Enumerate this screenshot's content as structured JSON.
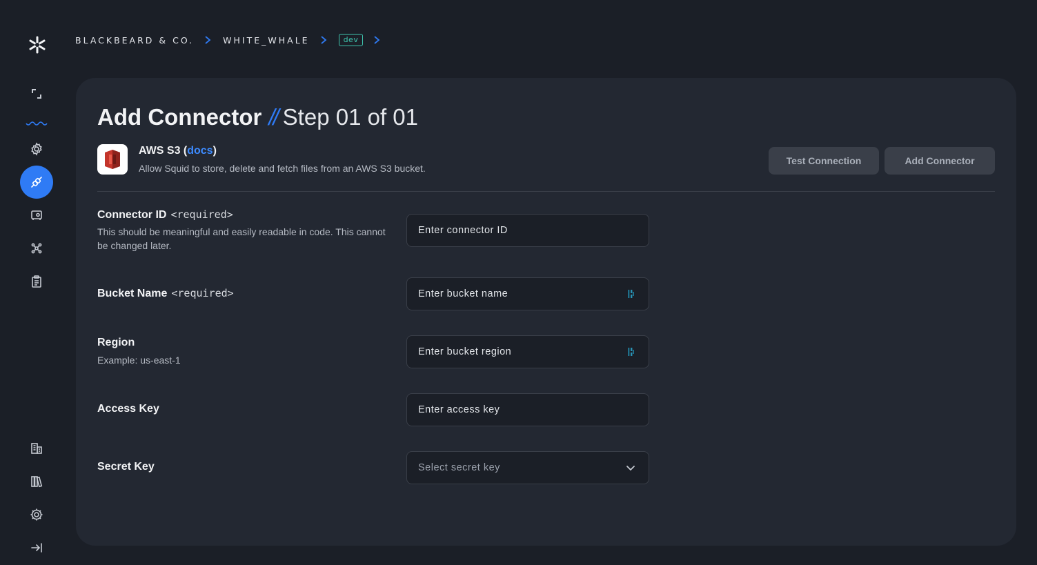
{
  "breadcrumb": {
    "org": "BLACKBEARD & CO.",
    "app": "WHITE_WHALE",
    "env": "dev"
  },
  "sidebar": {
    "logo_icon": "squid-logo-icon",
    "items": [
      {
        "name": "overview",
        "icon": "expand-corners-icon"
      },
      {
        "name": "settings",
        "icon": "gear-icon"
      },
      {
        "name": "connectors",
        "icon": "plug-icon",
        "active": true
      },
      {
        "name": "secrets",
        "icon": "vault-icon"
      },
      {
        "name": "integrations",
        "icon": "graph-nodes-icon"
      },
      {
        "name": "logs",
        "icon": "clipboard-icon"
      }
    ],
    "bottom_items": [
      {
        "name": "organization",
        "icon": "building-icon"
      },
      {
        "name": "docs",
        "icon": "books-icon"
      },
      {
        "name": "account-settings",
        "icon": "settings-icon"
      },
      {
        "name": "collapse",
        "icon": "collapse-arrow-icon"
      }
    ],
    "accent_color": "#2f7bf5"
  },
  "header": {
    "title": "Add Connector",
    "separator": "//",
    "step": "Step 01 of 01"
  },
  "integration": {
    "name_prefix": "AWS S3 (",
    "docs_label": "docs",
    "name_suffix": ")",
    "description": "Allow Squid to store, delete and fetch files from an AWS S3 bucket.",
    "logo_icon": "aws-s3-bucket-icon"
  },
  "actions": {
    "test_label": "Test Connection",
    "add_label": "Add Connector"
  },
  "form": {
    "connector_id": {
      "label": "Connector ID",
      "required": "<required>",
      "help": "This should be meaningful and easily readable in code. This cannot be changed later.",
      "placeholder": "Enter connector ID"
    },
    "bucket_name": {
      "label": "Bucket Name",
      "required": "<required>",
      "placeholder": "Enter bucket name"
    },
    "region": {
      "label": "Region",
      "help": "Example: us-east-1",
      "placeholder": "Enter bucket region"
    },
    "access_key": {
      "label": "Access Key",
      "placeholder": "Enter access key"
    },
    "secret_key": {
      "label": "Secret Key",
      "placeholder": "Select secret key"
    }
  }
}
